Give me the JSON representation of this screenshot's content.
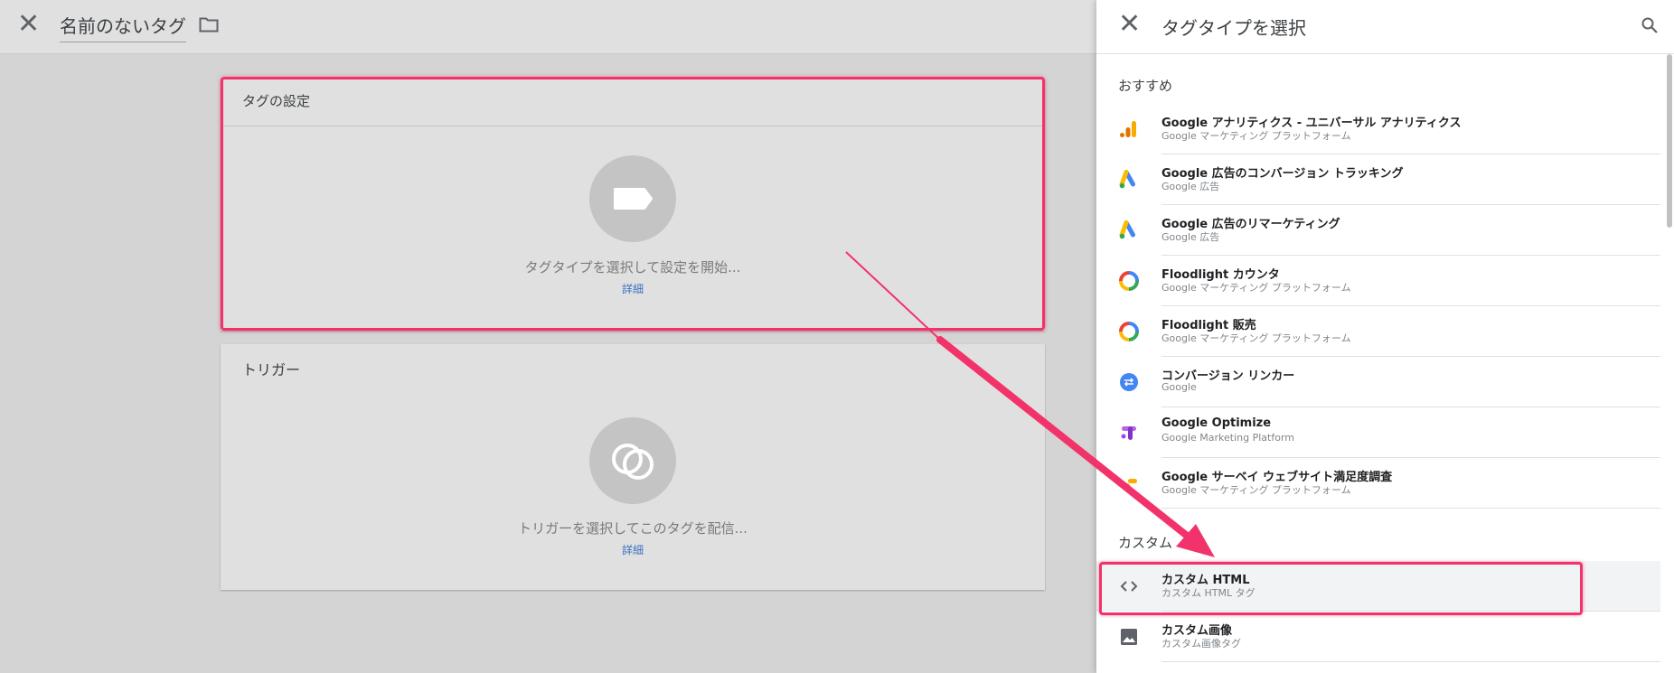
{
  "editor": {
    "title": "名前のないタグ",
    "config_card": {
      "header": "タグの設定",
      "message": "タグタイプを選択して設定を開始...",
      "link": "詳細"
    },
    "trigger_card": {
      "header": "トリガー",
      "message": "トリガーを選択してこのタグを配信...",
      "link": "詳細"
    }
  },
  "panel": {
    "title": "タグタイプを選択",
    "sections": {
      "recommended": "おすすめ",
      "custom": "カスタム"
    },
    "recommended_items": [
      {
        "name": "Google アナリティクス - ユニバーサル アナリティクス",
        "sub": "Google マーケティング プラットフォーム",
        "icon": "google-analytics-icon"
      },
      {
        "name": "Google 広告のコンバージョン トラッキング",
        "sub": "Google 広告",
        "icon": "google-ads-icon"
      },
      {
        "name": "Google 広告のリマーケティング",
        "sub": "Google 広告",
        "icon": "google-ads-icon"
      },
      {
        "name": "Floodlight カウンタ",
        "sub": "Google マーケティング プラットフォーム",
        "icon": "floodlight-icon"
      },
      {
        "name": "Floodlight 販売",
        "sub": "Google マーケティング プラットフォーム",
        "icon": "floodlight-icon"
      },
      {
        "name": "コンバージョン リンカー",
        "sub": "Google",
        "icon": "conversion-linker-icon"
      },
      {
        "name": "Google Optimize",
        "sub": "Google Marketing Platform",
        "icon": "google-optimize-icon"
      },
      {
        "name": "Google サーベイ ウェブサイト満足度調査",
        "sub": "Google マーケティング プラットフォーム",
        "icon": "google-surveys-icon"
      }
    ],
    "custom_items": [
      {
        "name": "カスタム HTML",
        "sub": "カスタム HTML タグ",
        "icon": "code-icon"
      },
      {
        "name": "カスタム画像",
        "sub": "カスタム画像タグ",
        "icon": "image-icon"
      }
    ]
  },
  "colors": {
    "highlight": "#f2336b",
    "link": "#3b6fc4"
  }
}
